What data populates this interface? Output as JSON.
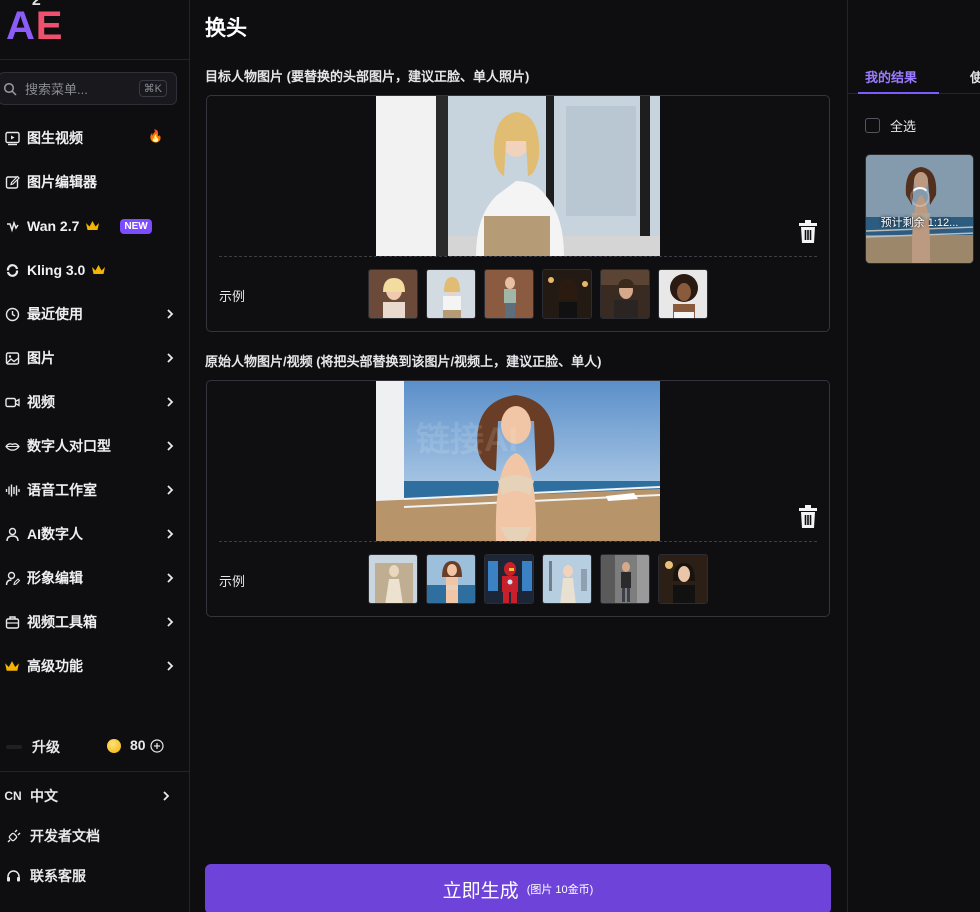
{
  "brand": {
    "logo_a": "A",
    "logo_sup": "2",
    "logo_e": "E"
  },
  "search": {
    "placeholder": "搜索菜单...",
    "shortcut": "⌘K"
  },
  "sidebar": {
    "items": [
      {
        "label": "图生视频",
        "icon": "play-square-icon",
        "extra": "fire-icon"
      },
      {
        "label": "图片编辑器",
        "icon": "edit-icon"
      },
      {
        "label": "Wan 2.7",
        "icon": "wan-icon",
        "extra": "crown-icon",
        "badge": "NEW"
      },
      {
        "label": "Kling 3.0",
        "icon": "kling-icon",
        "extra": "crown-icon"
      },
      {
        "label": "最近使用",
        "icon": "clock-icon"
      },
      {
        "label": "图片",
        "icon": "image-icon"
      },
      {
        "label": "视频",
        "icon": "video-icon"
      },
      {
        "label": "数字人对口型",
        "icon": "lips-icon"
      },
      {
        "label": "语音工作室",
        "icon": "waveform-icon"
      },
      {
        "label": "AI数字人",
        "icon": "person-icon"
      },
      {
        "label": "形象编辑",
        "icon": "person-edit-icon"
      },
      {
        "label": "视频工具箱",
        "icon": "toolbox-icon"
      },
      {
        "label": "高级功能",
        "icon": "crown-icon"
      }
    ],
    "upgrade_label": "升级",
    "credits": "80",
    "language_code": "CN",
    "language": "中文",
    "dev_docs": "开发者文档",
    "support": "联系客服"
  },
  "main": {
    "title": "换头",
    "target_label": "目标人物图片 (要替换的头部图片，建议正脸、单人照片)",
    "source_label": "原始人物图片/视频 (将把头部替换到该图片/视频上，建议正脸、单人)",
    "example_label": "示例",
    "generate_label": "立即生成",
    "generate_cost": "(图片 10金币)"
  },
  "results": {
    "tab_mine": "我的结果",
    "tab_other": "使",
    "select_all": "全选",
    "eta_text": "预计剩余 1:12..."
  },
  "colors": {
    "accent": "#6e43d9",
    "tab_active": "#9b7bff",
    "badge_new": "#7c4dff",
    "fire": "#ff7a1a",
    "crown": "#f5b400"
  }
}
